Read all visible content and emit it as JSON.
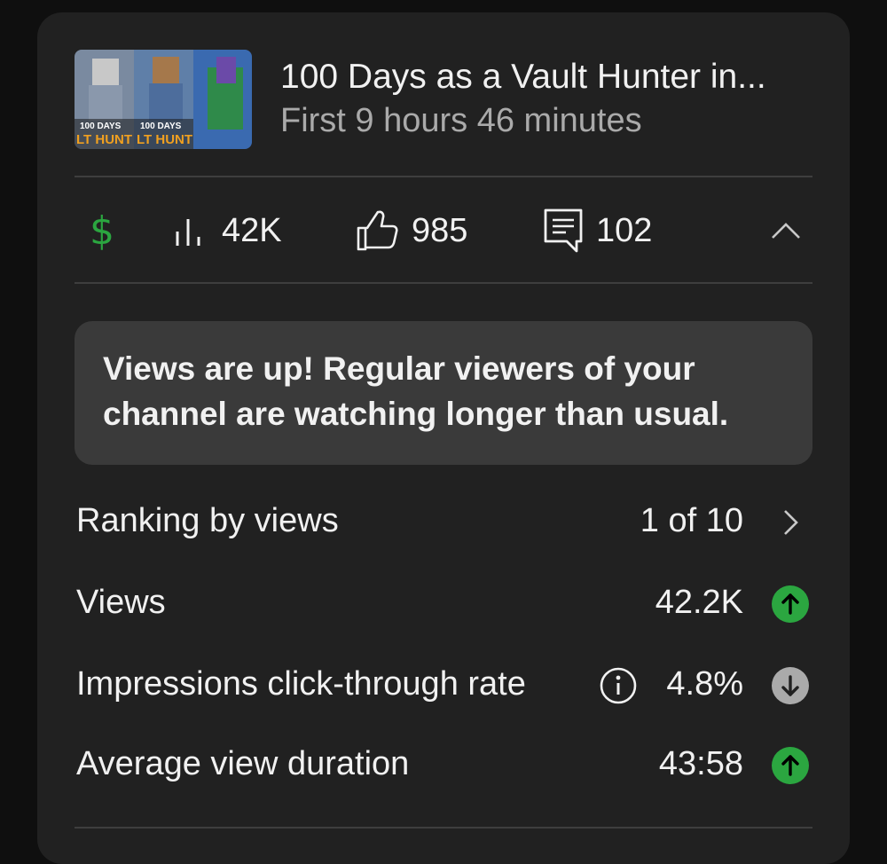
{
  "video": {
    "title": "100 Days as a Vault Hunter in...",
    "subtitle": "First 9 hours 46 minutes",
    "thumbnail_text": [
      "100 DAYS",
      "100 DAYS",
      "LT HUNT",
      "LT HUNT"
    ]
  },
  "stats": {
    "views": "42K",
    "likes": "985",
    "comments": "102"
  },
  "insight": {
    "text": "Views are up! Regular viewers of your channel are watching longer than usual."
  },
  "metrics": [
    {
      "label": "Ranking by views",
      "value": "1 of 10",
      "trail": "chevron-right-icon"
    },
    {
      "label": "Views",
      "value": "42.2K",
      "trail": "arrow-up-icon"
    },
    {
      "label": "Impressions click-through rate",
      "value": "4.8%",
      "trail": "arrow-down-icon"
    },
    {
      "label": "Average view duration",
      "value": "43:58",
      "trail": "arrow-up-icon"
    }
  ],
  "colors": {
    "monetization": "#2ba640",
    "trend_up": "#2ba640",
    "trend_down": "#aaaaaa",
    "card_bg": "#212121",
    "insight_bg": "#3a3a3a"
  }
}
